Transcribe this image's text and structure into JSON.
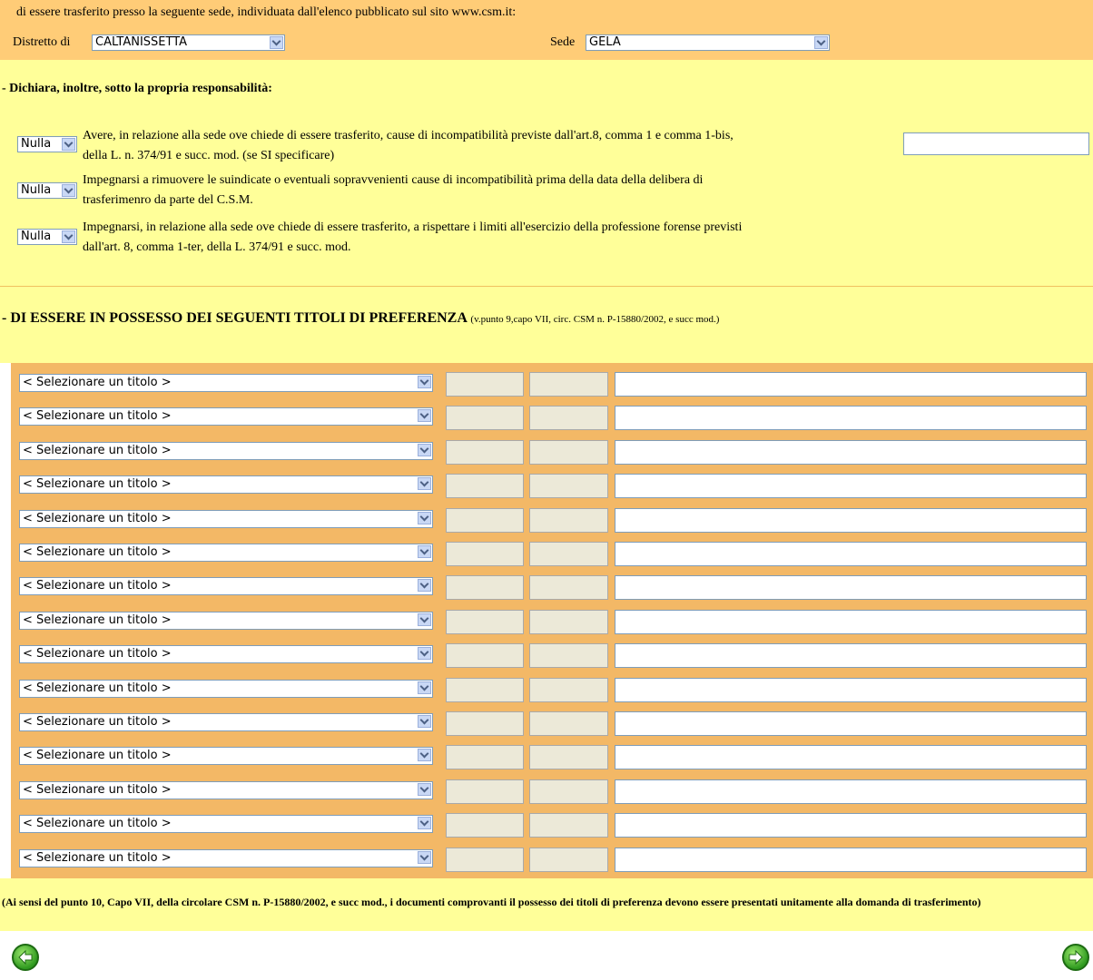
{
  "intro_text": "di essere trasferito presso la seguente sede, individuata dall'elenco pubblicato sul sito www.csm.it:",
  "distretto": {
    "label": "Distretto di",
    "value": "CALTANISSETTA"
  },
  "sede": {
    "label": "Sede",
    "value": "GELA"
  },
  "dichiara_title": "- Dichiara, inoltre, sotto la propria responsabilità:",
  "declarations": [
    {
      "select": "Nulla",
      "line1": "Avere, in relazione alla sede ove chiede di essere trasferito, cause di incompatibilità previste dall'art.8, comma 1 e comma 1-bis,",
      "line2": "della L. n. 374/91 e succ. mod. (se SI specificare)"
    },
    {
      "select": "Nulla",
      "line1": "Impegnarsi a rimuovere le suindicate o eventuali sopravvenienti cause di incompatibilità prima della data della delibera di",
      "line2": "trasferimenro da parte del C.S.M."
    },
    {
      "select": "Nulla",
      "line1": "Impegnarsi, in relazione alla sede ove chiede di essere trasferito, a rispettare i limiti all'esercizio della professione forense previsti",
      "line2": "dall'art. 8, comma 1-ter, della L. 374/91 e succ. mod."
    }
  ],
  "titoli": {
    "heading": "- DI ESSERE IN POSSESSO DEI SEGUENTI TITOLI DI PREFERENZA",
    "heading_note": "(v.punto 9,capo VII, circ. CSM n. P-15880/2002, e succ mod.)",
    "placeholder_option": "< Selezionare un titolo >",
    "row_count": 15
  },
  "footer_note": "(Ai sensi del punto 10, Capo VII, della circolare CSM n. P-15880/2002, e succ mod., i documenti comprovanti il possesso dei titoli di preferenza devono essere presentati unitamente alla domanda di trasferimento)",
  "nav": {
    "back_icon": "arrow-left-icon",
    "forward_icon": "arrow-right-icon"
  },
  "colors": {
    "top_band": "#ffcc77",
    "yellow_band": "#ffff99",
    "table_bg": "#f3b866"
  }
}
